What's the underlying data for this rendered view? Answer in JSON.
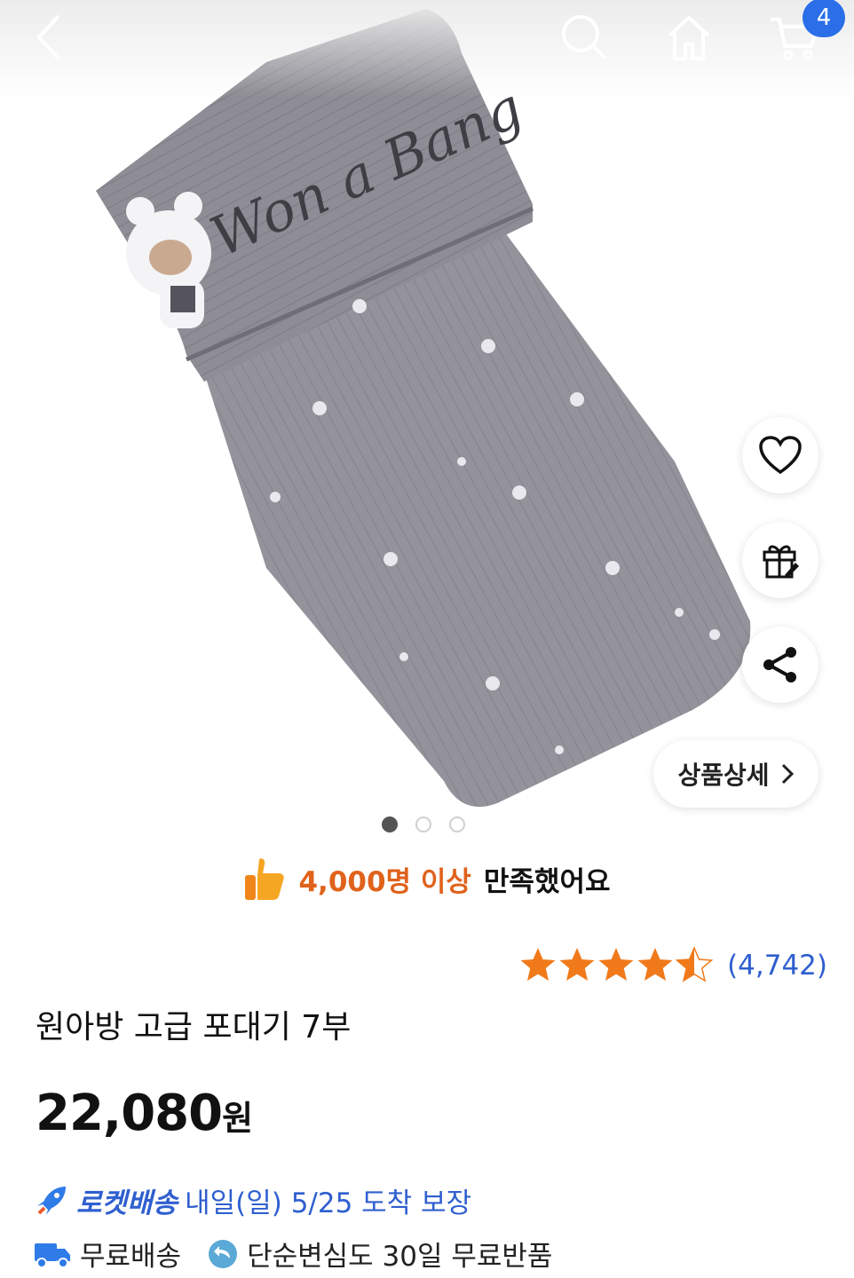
{
  "header": {
    "back_icon": "chevron-left-icon",
    "search_icon": "search-icon",
    "home_icon": "home-icon",
    "cart_icon": "cart-icon",
    "cart_count": "4"
  },
  "product_image": {
    "embroidery_text": "Won a Bang",
    "slide_count": 3,
    "active_slide": 1
  },
  "side_actions": {
    "wishlist_icon": "heart-icon",
    "gift_icon": "gift-icon",
    "share_icon": "share-icon",
    "detail_label": "상품상세"
  },
  "satisfaction": {
    "highlight": "4,000명 이상",
    "rest": "만족했어요"
  },
  "rating": {
    "stars": 4.5,
    "review_count": "(4,742)"
  },
  "product": {
    "title": "원아방 고급 포대기 7부",
    "price": "22,080",
    "currency": "원"
  },
  "delivery": {
    "rocket_label": "로켓배송",
    "rocket_eta": "내일(일) 5/25 도착 보장",
    "free_shipping": "무료배송",
    "return_policy": "단순변심도 30일 무료반품"
  },
  "colors": {
    "accent_blue": "#2f5fcf",
    "badge_blue": "#2a6ee8",
    "highlight_orange": "#e0621b",
    "star_orange": "#f07a1a"
  }
}
